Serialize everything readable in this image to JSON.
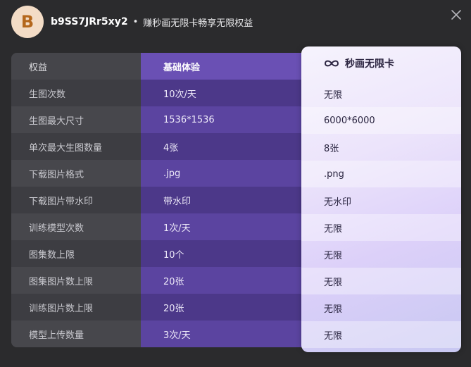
{
  "header": {
    "avatar_letter": "B",
    "username": "b9SS7JRr5xy2",
    "separator": "•",
    "slogan": "赚秒画无限卡畅享无限权益"
  },
  "table": {
    "columns": [
      "权益",
      "基础体验",
      "秒画无限卡"
    ],
    "rows": [
      [
        "生图次数",
        "10次/天",
        "无限"
      ],
      [
        "生图最大尺寸",
        "1536*1536",
        "6000*6000"
      ],
      [
        "单次最大生图数量",
        "4张",
        "8张"
      ],
      [
        "下载图片格式",
        ".jpg",
        ".png"
      ],
      [
        "下载图片带水印",
        "带水印",
        "无水印"
      ],
      [
        "训练模型次数",
        "1次/天",
        "无限"
      ],
      [
        "图集数上限",
        "10个",
        "无限"
      ],
      [
        "图集图片数上限",
        "20张",
        "无限"
      ],
      [
        "训练图片数上限",
        "20张",
        "无限"
      ],
      [
        "模型上传数量",
        "3次/天",
        "无限"
      ]
    ]
  },
  "icons": {
    "close": "close-icon",
    "premium": "infinity-icon"
  },
  "colors": {
    "basic_column": "#4c3889",
    "premium_column": "#e6dcfb"
  }
}
